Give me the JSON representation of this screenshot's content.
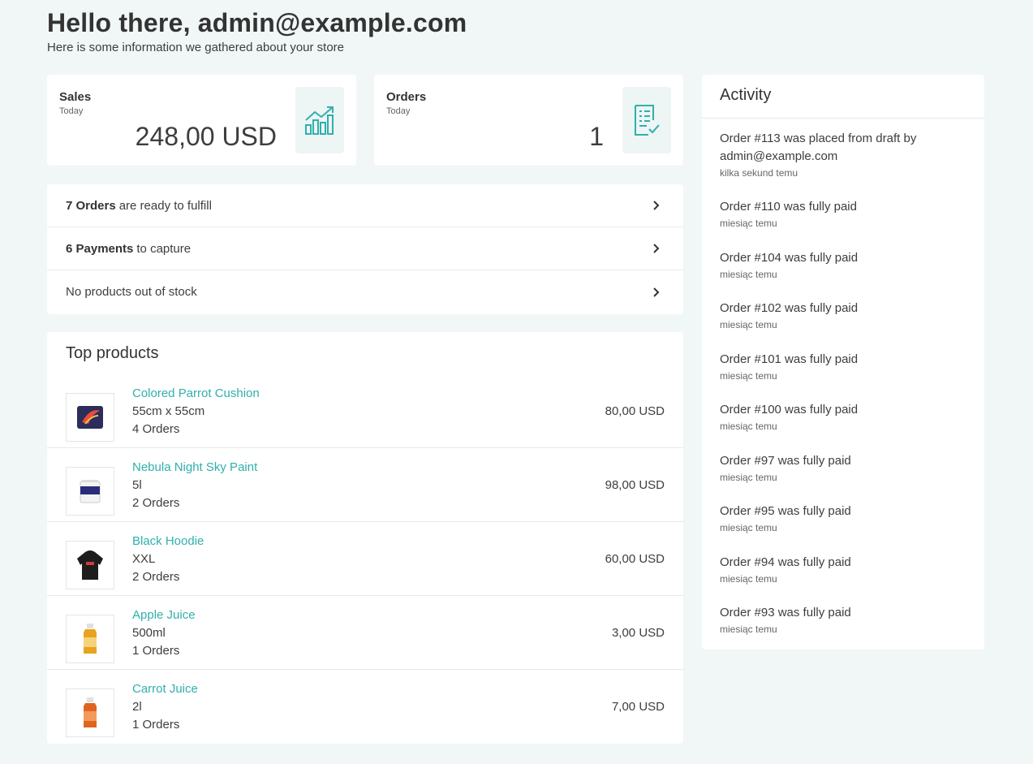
{
  "header": {
    "title": "Hello there, admin@example.com",
    "subtitle": "Here is some information we gathered about your store"
  },
  "stats": {
    "sales": {
      "title": "Sales",
      "period": "Today",
      "value": "248,00 USD",
      "icon": "chart-growth-icon"
    },
    "orders": {
      "title": "Orders",
      "period": "Today",
      "value": "1",
      "icon": "checklist-icon"
    }
  },
  "notifications": [
    {
      "bold": "7 Orders",
      "text": "are ready to fulfill"
    },
    {
      "bold": "6 Payments",
      "text": "to capture"
    },
    {
      "bold": "",
      "text": "No products out of stock"
    }
  ],
  "top_products": {
    "heading": "Top products",
    "items": [
      {
        "name": "Colored Parrot Cushion",
        "variant": "55cm x 55cm",
        "orders": "4 Orders",
        "price": "80,00 USD",
        "thumb": "cushion"
      },
      {
        "name": "Nebula Night Sky Paint",
        "variant": "5l",
        "orders": "2 Orders",
        "price": "98,00 USD",
        "thumb": "paint"
      },
      {
        "name": "Black Hoodie",
        "variant": "XXL",
        "orders": "2 Orders",
        "price": "60,00 USD",
        "thumb": "hoodie"
      },
      {
        "name": "Apple Juice",
        "variant": "500ml",
        "orders": "1 Orders",
        "price": "3,00 USD",
        "thumb": "apple-juice"
      },
      {
        "name": "Carrot Juice",
        "variant": "2l",
        "orders": "1 Orders",
        "price": "7,00 USD",
        "thumb": "carrot-juice"
      }
    ]
  },
  "activity": {
    "heading": "Activity",
    "items": [
      {
        "text": "Order #113 was placed from draft by admin@example.com",
        "time": "kilka sekund temu"
      },
      {
        "text": "Order #110 was fully paid",
        "time": "miesiąc temu"
      },
      {
        "text": "Order #104 was fully paid",
        "time": "miesiąc temu"
      },
      {
        "text": "Order #102 was fully paid",
        "time": "miesiąc temu"
      },
      {
        "text": "Order #101 was fully paid",
        "time": "miesiąc temu"
      },
      {
        "text": "Order #100 was fully paid",
        "time": "miesiąc temu"
      },
      {
        "text": "Order #97 was fully paid",
        "time": "miesiąc temu"
      },
      {
        "text": "Order #95 was fully paid",
        "time": "miesiąc temu"
      },
      {
        "text": "Order #94 was fully paid",
        "time": "miesiąc temu"
      },
      {
        "text": "Order #93 was fully paid",
        "time": "miesiąc temu"
      }
    ]
  },
  "colors": {
    "accent": "#2fb0ad",
    "background": "#f1f6f6",
    "icon_box": "#eef5f5"
  }
}
